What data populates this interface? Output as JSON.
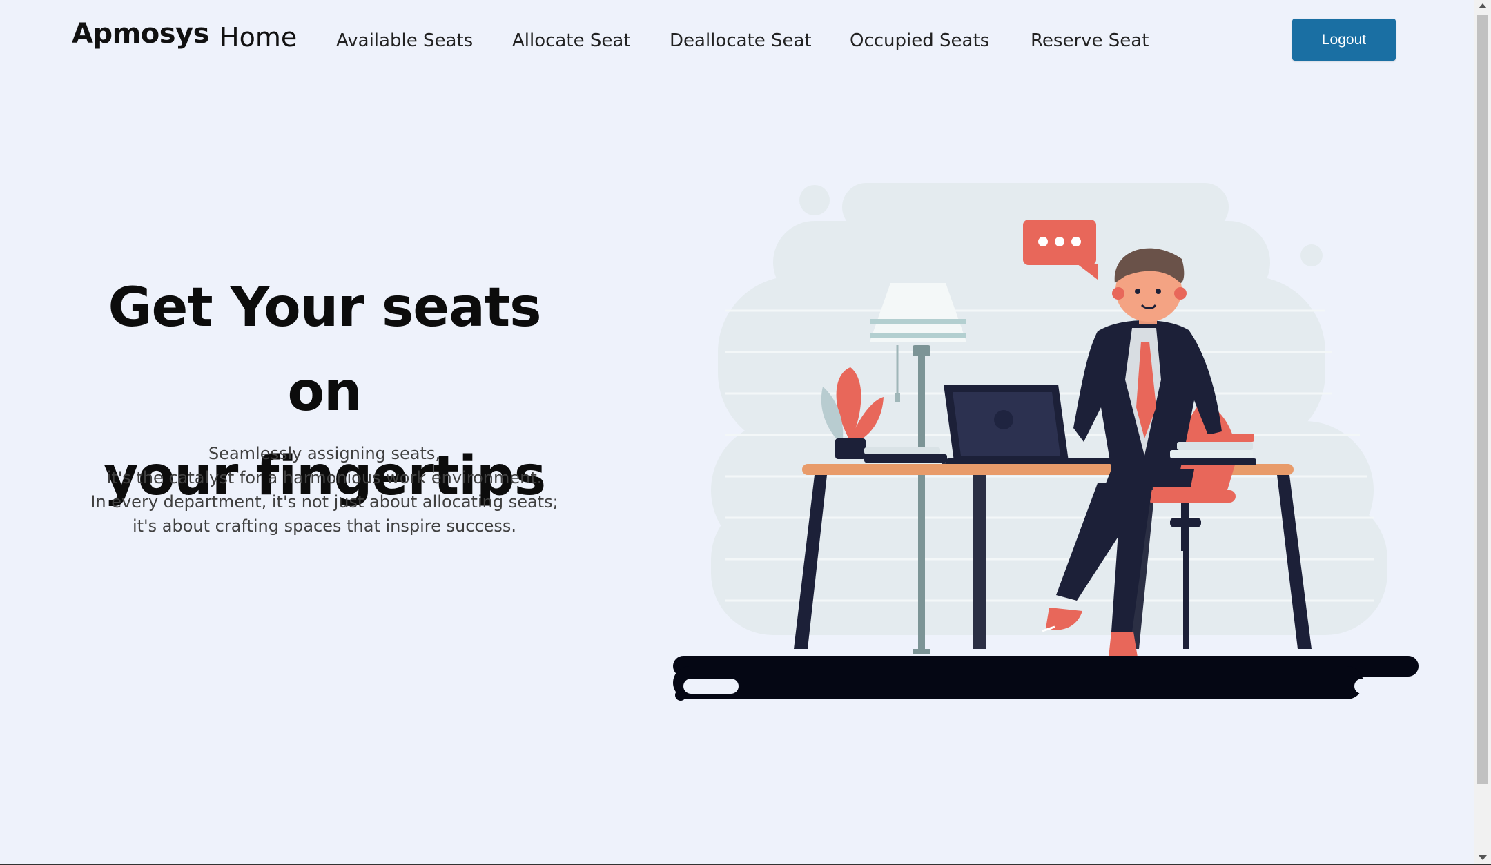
{
  "navbar": {
    "brand": "Apmosys",
    "home": "Home",
    "items": [
      {
        "label": "Available Seats"
      },
      {
        "label": "Allocate Seat"
      },
      {
        "label": "Deallocate Seat"
      },
      {
        "label": "Occupied Seats"
      },
      {
        "label": "Reserve Seat"
      }
    ],
    "logout_label": "Logout"
  },
  "hero": {
    "title_line1": "Get Your seats on",
    "title_line2": "your fingertips",
    "subtitle": [
      "Seamlessly assigning seats,",
      "it's the catalyst for a harmonious work environment.",
      "In every department, it's not just about allocating seats;",
      "it's about crafting spaces that inspire success."
    ]
  },
  "colors": {
    "background": "#eef2fb",
    "accent": "#1a6fa3",
    "illustration_primary": "#e8675a",
    "illustration_dark": "#1c2038"
  },
  "icons": {
    "speech_bubble": "speech-bubble-icon"
  }
}
